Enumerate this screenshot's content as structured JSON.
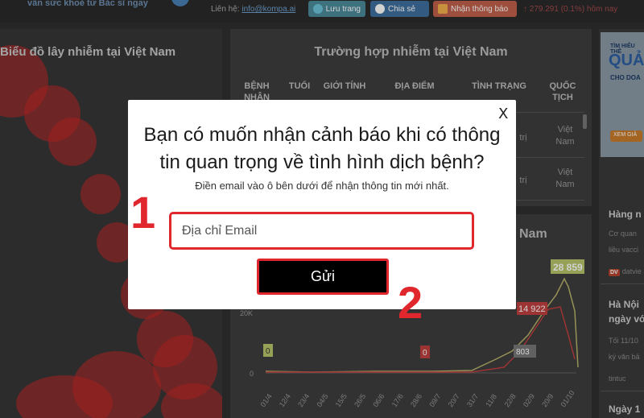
{
  "topbar": {
    "tagline": "vấn sức khoẻ từ Bác sĩ ngay",
    "contact_label": "Liên hệ:",
    "contact_email": "info@kompa.ai",
    "save_label": "Lưu trang",
    "share_label": "Chia sẻ",
    "notify_label": "Nhận thông báo",
    "stat_text": "↑ 279.291 (0.1%) hôm nay"
  },
  "map": {
    "title": "Biểu đồ lây nhiễm tại Việt Nam"
  },
  "table": {
    "title": "Trường hợp nhiễm tại Việt Nam",
    "headers": [
      "BỆNH NHÂN",
      "TUỔI",
      "GIỚI TÍNH",
      "ĐỊA ĐIỂM",
      "TÌNH TRẠNG",
      "QUỐC TỊCH"
    ],
    "rows": [
      {
        "status": "trị",
        "nationality": "Việt Nam"
      },
      {
        "status": "trị",
        "nationality": "Việt Nam"
      }
    ]
  },
  "chart": {
    "title_fragment": "Nam",
    "peak_label": "28 859",
    "label_mid": "14 922",
    "label_low": "803",
    "zero_labels": [
      "0",
      "0"
    ],
    "y_ticks": [
      "20K",
      "0"
    ],
    "x_ticks": [
      "01/4",
      "12/4",
      "23/4",
      "04/5",
      "15/5",
      "26/5",
      "06/6",
      "17/6",
      "28/6",
      "09/7",
      "20/7",
      "31/7",
      "11/8",
      "22/8",
      "02/9",
      "20/9",
      "01/10"
    ]
  },
  "sidebar": {
    "ad_line1": "TÌM HIỂU THÊ",
    "ad_line2": "QUẢ",
    "ad_line3": "CHO DOA",
    "ad_button": "XEM GIẢ",
    "news": [
      {
        "title": "Hàng n",
        "snippet1": "Cơ quan",
        "snippet2": "liều vacci",
        "source": "datvie",
        "source_badge": "DV"
      },
      {
        "title1": "Hà Nội",
        "title2": "ngày vớ",
        "snippet1": "Tối 11/10",
        "snippet2": "ký văn bả",
        "source": "tintuc"
      },
      {
        "title": "Ngày 1"
      }
    ]
  },
  "modal": {
    "close_label": "X",
    "title": "Bạn có muốn nhận cảnh báo khi có thông tin quan trọng về tình hình dịch bệnh?",
    "subtitle": "Điền email vào ô bên dưới để nhận thông tin mới nhất.",
    "email_placeholder": "Địa chỉ Email",
    "email_value": "",
    "submit_label": "Gửi",
    "step1": "1",
    "step2": "2"
  },
  "colors": {
    "accent_red": "#e0272d",
    "modal_bg": "#ffffff",
    "button_bg": "#000000"
  }
}
